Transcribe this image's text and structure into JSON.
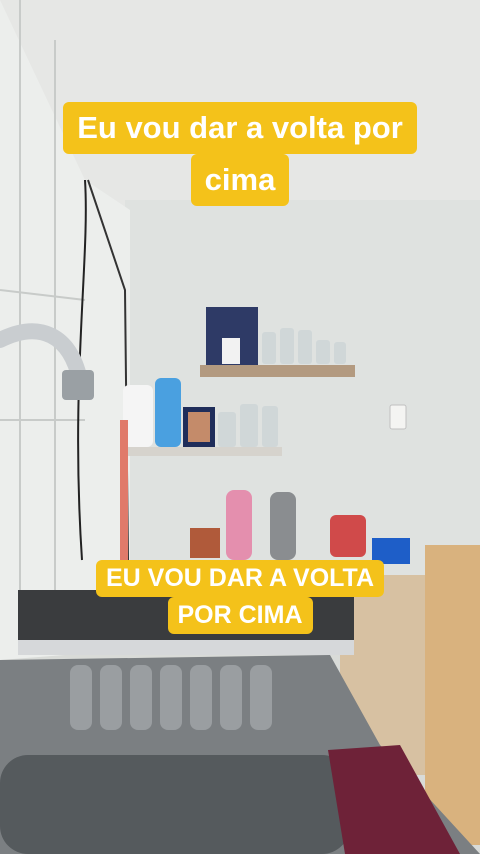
{
  "captions": {
    "top": [
      "Eu vou dar a volta por",
      "cima"
    ],
    "bottom": [
      "EU VOU DAR A VOLTA",
      "POR CIMA"
    ],
    "background_color": "#f4c21a",
    "text_color": "#ffffff"
  },
  "scene": {
    "description_icons": [
      "kitchen-scene"
    ]
  }
}
